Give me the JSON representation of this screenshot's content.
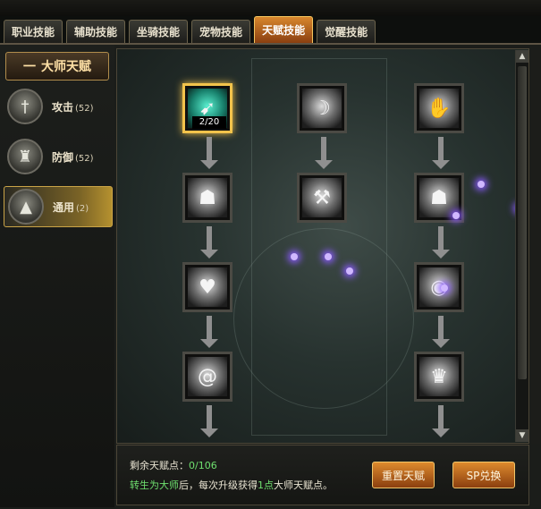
{
  "tabs": [
    {
      "label": "职业技能",
      "active": false
    },
    {
      "label": "辅助技能",
      "active": false
    },
    {
      "label": "坐骑技能",
      "active": false
    },
    {
      "label": "宠物技能",
      "active": false
    },
    {
      "label": "天赋技能",
      "active": true
    },
    {
      "label": "觉醒技能",
      "active": false
    }
  ],
  "sidebar": {
    "header": {
      "dash": "一",
      "title": "大师天赋"
    },
    "categories": [
      {
        "label": "攻击",
        "count": "(52)",
        "icon": "sword-icon",
        "active": false
      },
      {
        "label": "防御",
        "count": "(52)",
        "icon": "shield-figure-icon",
        "active": false
      },
      {
        "label": "通用",
        "count": "(2)",
        "icon": "triangle-emblem-icon",
        "active": true
      }
    ]
  },
  "talent_tree": {
    "selected_count": "2/20",
    "nodes": [
      {
        "icon": "dash-figure-icon"
      },
      {
        "icon": "slash-figure-icon"
      },
      {
        "icon": "claw-strike-icon"
      },
      {
        "icon": "brute-icon"
      },
      {
        "icon": "hammer-icon"
      },
      {
        "icon": "warrior-icon"
      },
      {
        "icon": "heart-icon"
      },
      {
        "icon": "meditation-icon"
      },
      {
        "icon": "vortex-icon"
      },
      {
        "icon": "aura-icon"
      }
    ]
  },
  "scrollbar": {
    "up": "▲",
    "down": "▼"
  },
  "footer": {
    "remaining_label": "剩余天赋点：",
    "remaining_value": "0/106",
    "info_green_1": "转生为大师",
    "info_text_1": "后，每次升级获得",
    "info_green_2": "1点",
    "info_text_2": "大师天赋点。",
    "reset_button": "重置天赋",
    "sp_button": "SP兑换"
  },
  "colors": {
    "accent": "#f2c34b",
    "green_text": "#6fe06f",
    "button": "#c8722a"
  }
}
